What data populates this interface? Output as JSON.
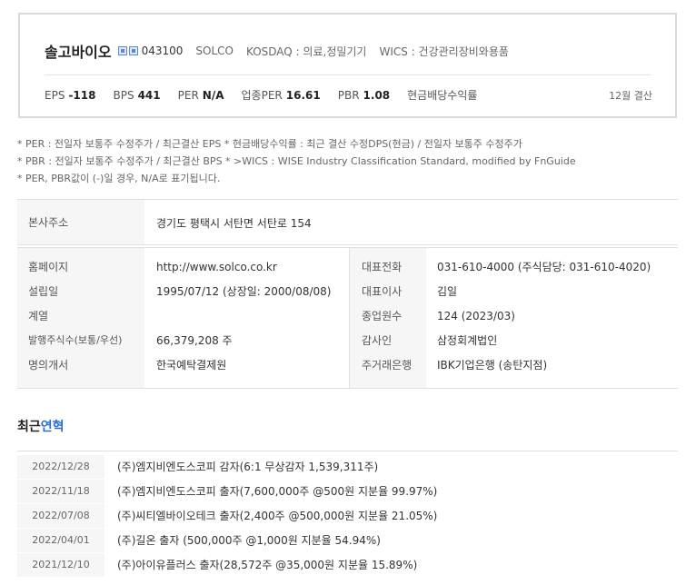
{
  "header": {
    "company_name": "솔고바이오",
    "code": "043100",
    "english_name": "SOLCO",
    "market": "KOSDAQ : 의료,정밀기기",
    "wics": "WICS : 건강관리장비와용품",
    "fiscal_month": "12월 결산"
  },
  "metrics": [
    {
      "label": "EPS",
      "value": "-118"
    },
    {
      "label": "BPS",
      "value": "441"
    },
    {
      "label": "PER",
      "value": "N/A"
    },
    {
      "label": "업종PER",
      "value": "16.61"
    },
    {
      "label": "PBR",
      "value": "1.08"
    },
    {
      "label": "현금배당수익률",
      "value": ""
    }
  ],
  "notes": [
    "* PER : 전일자 보통주 수정주가 / 최근결산 EPS * 현금배당수익률 : 최근 결산 수정DPS(현금) / 전일자 보통주 수정주가",
    "* PBR : 전일자 보통주 수정주가 / 최근결산 BPS * >WICS : WISE Industry Classification Standard, modified by FnGuide",
    "* PER, PBR값이 (-)일 경우, N/A로 표기됩니다."
  ],
  "address": {
    "label": "본사주소",
    "value": "경기도 평택시 서탄면 서탄로 154"
  },
  "info_left": [
    {
      "label": "홈페이지",
      "value": "http://www.solco.co.kr"
    },
    {
      "label": "설립일",
      "value": "1995/07/12 (상장일: 2000/08/08)"
    },
    {
      "label": "계열",
      "value": ""
    },
    {
      "label": "발행주식수(보통/우선)",
      "value": "66,379,208 주"
    },
    {
      "label": "명의개서",
      "value": "한국예탁결제원"
    }
  ],
  "info_right": [
    {
      "label": "대표전화",
      "value": "031-610-4000 (주식담당: 031-610-4020)"
    },
    {
      "label": "대표이사",
      "value": "김일"
    },
    {
      "label": "종업원수",
      "value": "124 (2023/03)"
    },
    {
      "label": "감사인",
      "value": "삼정회계법인"
    },
    {
      "label": "주거래은행",
      "value": "IBK기업은행 (송탄지점)"
    }
  ],
  "history": {
    "title_prefix": "최근",
    "title_accent": "연혁",
    "items": [
      {
        "date": "2022/12/28",
        "event": "(주)엠지비엔도스코피 감자(6:1 무상감자 1,539,311주)"
      },
      {
        "date": "2022/11/18",
        "event": "(주)엠지비엔도스코피 출자(7,600,000주 @500원 지분율 99.97%)"
      },
      {
        "date": "2022/07/08",
        "event": "(주)씨티엘바이오테크 출자(2,400주 @500,000원 지분율 21.05%)"
      },
      {
        "date": "2022/04/01",
        "event": "(주)길온 출자 (500,000주 @1,000원 지분율 54.94%)"
      },
      {
        "date": "2021/12/10",
        "event": "(주)아이유플러스 출자(28,572주 @35,000원 지분율 15.89%)"
      }
    ]
  }
}
